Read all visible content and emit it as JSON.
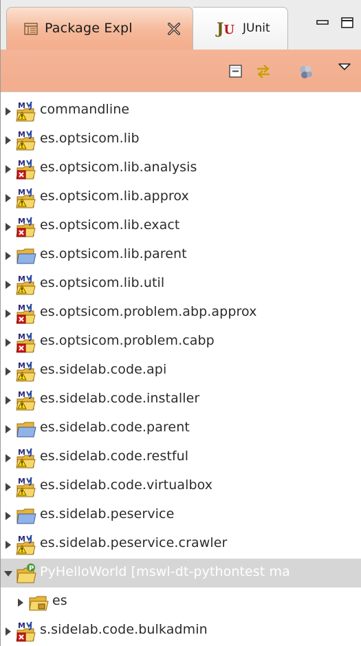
{
  "tabs": {
    "package_explorer": {
      "label": "Package Expl"
    },
    "junit": {
      "icon_text": "J",
      "icon_text_u": "U",
      "label": "JUnit"
    }
  },
  "colors": {
    "active_tab": "#f3ad8c",
    "selection": "#d6d6d6",
    "error_mark": "#d01a1a",
    "folder": "#f2c94c"
  },
  "tree": {
    "items": [
      {
        "label": "commandline",
        "icon": "maven-project-warning-icon",
        "level": 0,
        "expanded": false
      },
      {
        "label": "es.optsicom.lib",
        "icon": "maven-project-warning-icon",
        "level": 0,
        "expanded": false
      },
      {
        "label": "es.optsicom.lib.analysis",
        "icon": "maven-project-error-icon",
        "level": 0,
        "expanded": false
      },
      {
        "label": "es.optsicom.lib.approx",
        "icon": "maven-project-warning-icon",
        "level": 0,
        "expanded": false
      },
      {
        "label": "es.optsicom.lib.exact",
        "icon": "maven-project-error-icon",
        "level": 0,
        "expanded": false
      },
      {
        "label": "es.optsicom.lib.parent",
        "icon": "project-folder-icon",
        "level": 0,
        "expanded": false
      },
      {
        "label": "es.optsicom.lib.util",
        "icon": "maven-project-warning-icon",
        "level": 0,
        "expanded": false
      },
      {
        "label": "es.optsicom.problem.abp.approx",
        "icon": "maven-project-error-icon",
        "level": 0,
        "expanded": false
      },
      {
        "label": "es.optsicom.problem.cabp",
        "icon": "maven-project-error-icon",
        "level": 0,
        "expanded": false
      },
      {
        "label": "es.sidelab.code.api",
        "icon": "maven-project-warning-icon",
        "level": 0,
        "expanded": false
      },
      {
        "label": "es.sidelab.code.installer",
        "icon": "maven-project-warning-icon",
        "level": 0,
        "expanded": false
      },
      {
        "label": "es.sidelab.code.parent",
        "icon": "project-folder-icon",
        "level": 0,
        "expanded": false
      },
      {
        "label": "es.sidelab.code.restful",
        "icon": "maven-project-warning-icon",
        "level": 0,
        "expanded": false
      },
      {
        "label": "es.sidelab.code.virtualbox",
        "icon": "maven-project-warning-icon",
        "level": 0,
        "expanded": false
      },
      {
        "label": "es.sidelab.peservice",
        "icon": "project-folder-icon",
        "level": 0,
        "expanded": false
      },
      {
        "label": "es.sidelab.peservice.crawler",
        "icon": "maven-project-warning-icon",
        "level": 0,
        "expanded": false
      },
      {
        "label": "PyHelloWorld [mswl-dt-pythontest ma",
        "icon": "python-project-icon",
        "level": 0,
        "expanded": true,
        "selected": true
      },
      {
        "label": "es",
        "icon": "source-folder-icon",
        "level": 1,
        "expanded": false
      },
      {
        "label": "s.sidelab.code.bulkadmin",
        "icon": "maven-project-error-icon",
        "level": 0,
        "expanded": false
      }
    ]
  }
}
